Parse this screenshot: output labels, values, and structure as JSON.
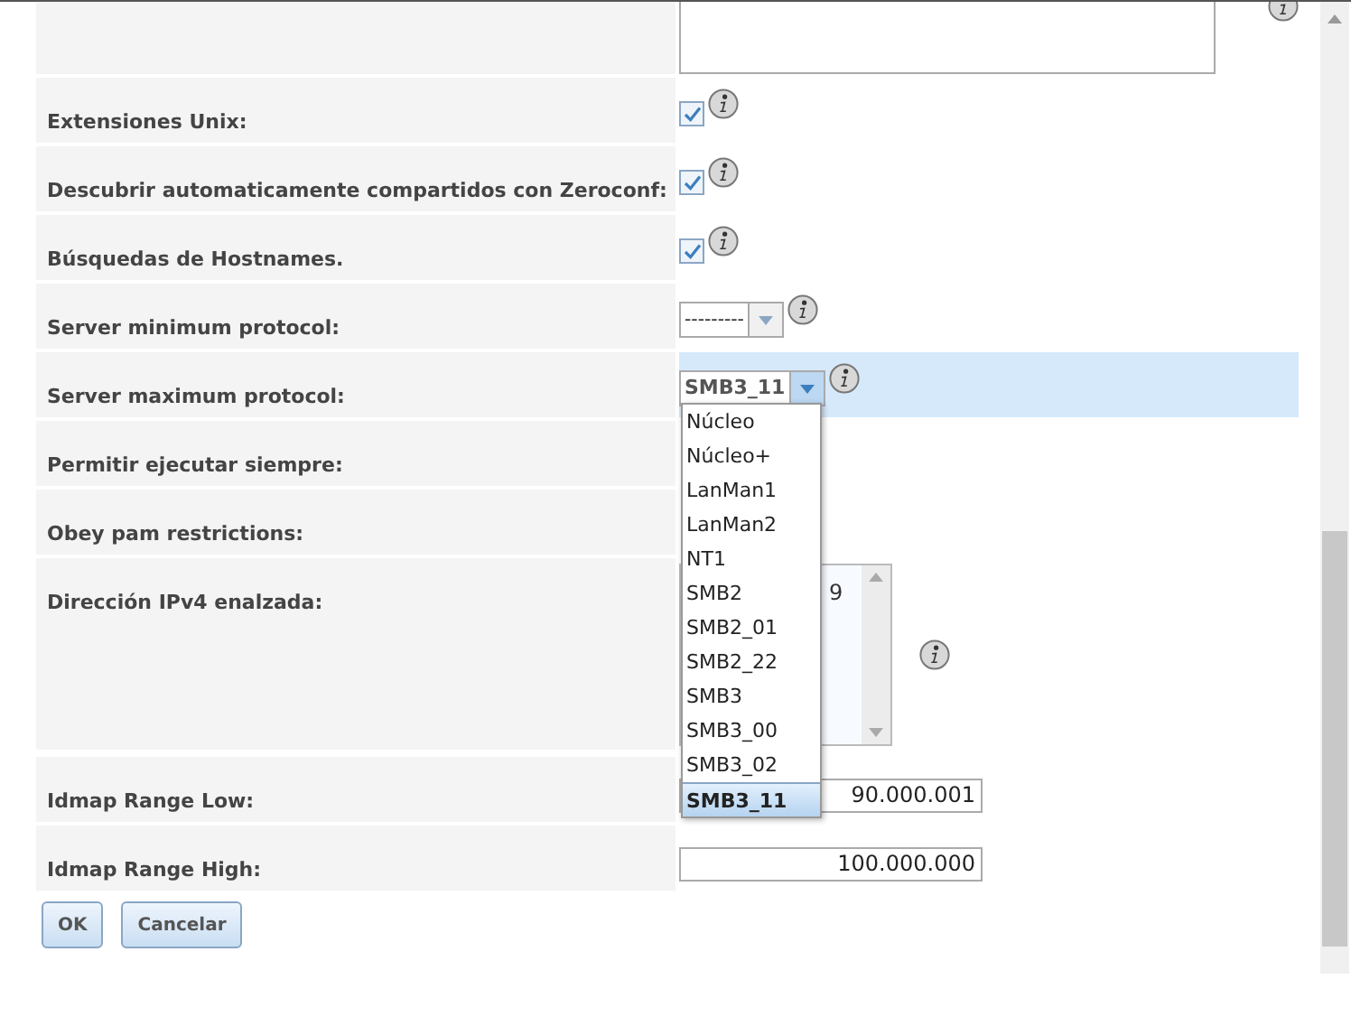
{
  "rows": [
    {
      "kind": "textarea",
      "info": true
    },
    {
      "kind": "checkbox",
      "label": "Extensiones Unix:",
      "checked": true,
      "info": true
    },
    {
      "kind": "checkbox",
      "label": "Descubrir automaticamente compartidos con Zeroconf:",
      "checked": true,
      "info": true
    },
    {
      "kind": "checkbox",
      "label": "Búsquedas de Hostnames.",
      "checked": true,
      "info": true
    },
    {
      "kind": "select",
      "label": "Server minimum protocol:",
      "value": "---------",
      "focused": false,
      "info": true
    },
    {
      "kind": "select",
      "label": "Server maximum protocol:",
      "value": "SMB3_11",
      "focused": true,
      "info": true
    },
    {
      "label": "Permitir ejecutar siempre:"
    },
    {
      "label": "Obey pam restrictions:"
    },
    {
      "kind": "listbox",
      "label": "Dirección IPv4 enalzada:",
      "visible_text": "9",
      "info": true
    },
    {
      "kind": "text",
      "label": "Idmap Range Low:",
      "value": "90.000.001"
    },
    {
      "kind": "text",
      "label": "Idmap Range High:",
      "value": "100.000.000"
    }
  ],
  "dropdown": {
    "options": [
      {
        "label": "Núcleo",
        "selected": false
      },
      {
        "label": "Núcleo+",
        "selected": false
      },
      {
        "label": "LanMan1",
        "selected": false
      },
      {
        "label": "LanMan2",
        "selected": false
      },
      {
        "label": "NT1",
        "selected": false
      },
      {
        "label": "SMB2",
        "selected": false
      },
      {
        "label": "SMB2_01",
        "selected": false
      },
      {
        "label": "SMB2_22",
        "selected": false
      },
      {
        "label": "SMB3",
        "selected": false
      },
      {
        "label": "SMB3_00",
        "selected": false
      },
      {
        "label": "SMB3_02",
        "selected": false
      },
      {
        "label": "SMB3_11",
        "selected": true
      }
    ]
  },
  "buttons": [
    "OK",
    "Cancelar"
  ]
}
